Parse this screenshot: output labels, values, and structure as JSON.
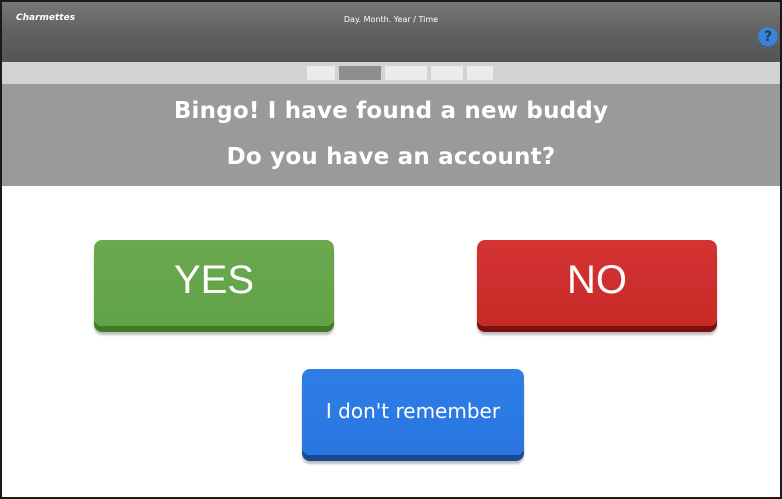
{
  "topbar": {
    "brand": "Charmettes",
    "datetime": "Day. Month. Year / Time",
    "help_glyph": "?",
    "help_icon": "question-circle-icon",
    "help_color": "#3b83d6"
  },
  "progress": {
    "total_steps": 5,
    "current_step": 2
  },
  "header": {
    "line1": "Bingo! I have found a new buddy",
    "line2": "Do you have an account?"
  },
  "buttons": {
    "yes": {
      "label": "YES",
      "color": "#6aa84f"
    },
    "no": {
      "label": "NO",
      "color": "#d43332"
    },
    "unsure": {
      "label": "I don't remember",
      "color": "#2f7ee6"
    }
  }
}
